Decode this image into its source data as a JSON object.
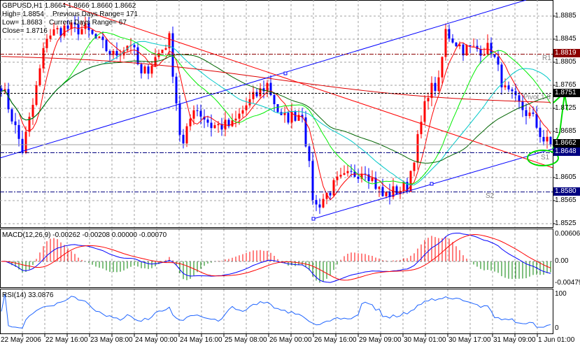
{
  "header": {
    "line1": "GBPUSD,H1  1.8664 1.8666 1.8660 1.8662",
    "high": "High= 1.8854",
    "prev_range": "Previous Days Range= 171",
    "low": "Low= 1.8683",
    "cur_range": "Current Days Range= 67",
    "close": "Close= 1.8716"
  },
  "price_axis": [
    "1.8885",
    "1.8845",
    "1.8805",
    "1.8765",
    "1.8725",
    "1.8685",
    "1.8605",
    "1.8565",
    "1.8525"
  ],
  "levels": {
    "r1": {
      "label": "R1",
      "price": "1.8819",
      "color": "#8b0000"
    },
    "pivot": {
      "label": "Pivot  1.8",
      "price": "1.8751",
      "color": "#000000"
    },
    "current": {
      "price": "1.8662",
      "color": "#000000"
    },
    "s1": {
      "label": "S1",
      "price": "1.8648",
      "color": "#000080"
    },
    "s2": {
      "label": "S2",
      "price": "1.8580",
      "color": "#000080"
    }
  },
  "macd": {
    "label": "MACD(12,26,9) -0.00262 -0.00208 0.00000 -0.00070",
    "axis": [
      "0.00606",
      "0.00",
      "-0.00479"
    ]
  },
  "rsi": {
    "label": "RSI(14) 33.0876",
    "axis": [
      "100",
      "0"
    ]
  },
  "dates": [
    "22 May 2006",
    "22 May 16:00",
    "23 May 08:00",
    "24 May 00:00",
    "24 May 16:00",
    "25 May 08:00",
    "26 May 00:00",
    "26 May 16:00",
    "29 May 09:00",
    "30 May 01:00",
    "30 May 17:00",
    "31 May 09:00",
    "1 Jun 01:00"
  ],
  "chart_data": {
    "type": "candlestick",
    "symbol": "GBPUSD",
    "timeframe": "H1",
    "ylim": [
      1.851,
      1.8915
    ],
    "colors": {
      "bull": "#ff0000",
      "bear": "#0000ff"
    },
    "price_waypoints": [
      [
        0,
        1.8767
      ],
      [
        6,
        1.8652
      ],
      [
        9,
        1.873
      ],
      [
        13,
        1.8852
      ],
      [
        18,
        1.8864
      ],
      [
        24,
        1.8862
      ],
      [
        32,
        1.8816
      ],
      [
        37,
        1.884
      ],
      [
        40,
        1.878
      ],
      [
        48,
        1.8845
      ],
      [
        51,
        1.8683
      ],
      [
        52,
        1.866
      ],
      [
        55,
        1.873
      ],
      [
        60,
        1.8695
      ],
      [
        66,
        1.8695
      ],
      [
        70,
        1.873
      ],
      [
        76,
        1.8767
      ],
      [
        80,
        1.8706
      ],
      [
        86,
        1.8718
      ],
      [
        89,
        1.8573
      ],
      [
        90,
        1.8555
      ],
      [
        96,
        1.8597
      ],
      [
        104,
        1.8621
      ],
      [
        109,
        1.8573
      ],
      [
        116,
        1.859
      ],
      [
        119,
        1.867
      ],
      [
        122,
        1.8755
      ],
      [
        125,
        1.8767
      ],
      [
        127,
        1.8858
      ],
      [
        132,
        1.8828
      ],
      [
        140,
        1.8828
      ],
      [
        142,
        1.8791
      ],
      [
        144,
        1.8755
      ],
      [
        148,
        1.873
      ],
      [
        152,
        1.8706
      ],
      [
        155,
        1.867
      ],
      [
        157,
        1.8662
      ]
    ],
    "macd_params": [
      12,
      26,
      9
    ],
    "rsi_period": 14
  }
}
